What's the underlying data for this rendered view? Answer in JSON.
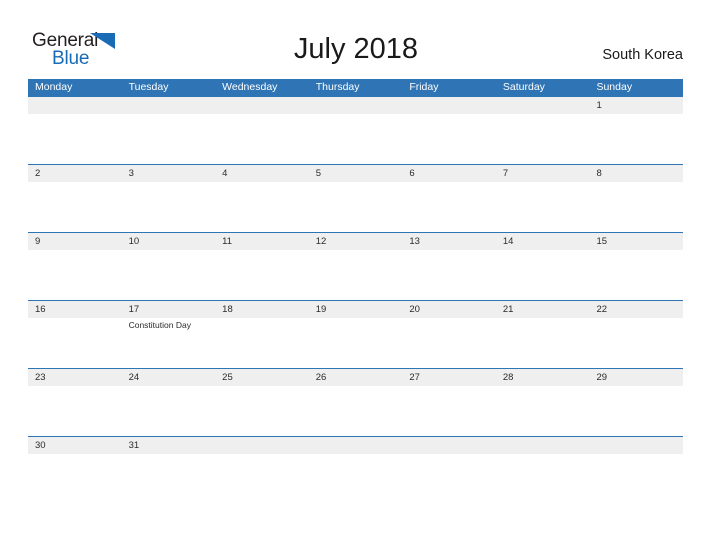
{
  "logo": {
    "word_one": "General",
    "word_two": "Blue",
    "triangle_icon": "triangle-icon",
    "dark_color": "#231f20",
    "blue_color": "#1a6bb5"
  },
  "header": {
    "title": "July 2018",
    "country": "South Korea",
    "accent_color": "#2f74b5"
  },
  "calendar": {
    "weekdays": [
      "Monday",
      "Tuesday",
      "Wednesday",
      "Thursday",
      "Friday",
      "Saturday",
      "Sunday"
    ],
    "band_color": "#efefef",
    "weeks": [
      {
        "days": [
          {
            "date": "",
            "event": ""
          },
          {
            "date": "",
            "event": ""
          },
          {
            "date": "",
            "event": ""
          },
          {
            "date": "",
            "event": ""
          },
          {
            "date": "",
            "event": ""
          },
          {
            "date": "",
            "event": ""
          },
          {
            "date": "1",
            "event": ""
          }
        ]
      },
      {
        "days": [
          {
            "date": "2",
            "event": ""
          },
          {
            "date": "3",
            "event": ""
          },
          {
            "date": "4",
            "event": ""
          },
          {
            "date": "5",
            "event": ""
          },
          {
            "date": "6",
            "event": ""
          },
          {
            "date": "7",
            "event": ""
          },
          {
            "date": "8",
            "event": ""
          }
        ]
      },
      {
        "days": [
          {
            "date": "9",
            "event": ""
          },
          {
            "date": "10",
            "event": ""
          },
          {
            "date": "11",
            "event": ""
          },
          {
            "date": "12",
            "event": ""
          },
          {
            "date": "13",
            "event": ""
          },
          {
            "date": "14",
            "event": ""
          },
          {
            "date": "15",
            "event": ""
          }
        ]
      },
      {
        "days": [
          {
            "date": "16",
            "event": ""
          },
          {
            "date": "17",
            "event": "Constitution Day"
          },
          {
            "date": "18",
            "event": ""
          },
          {
            "date": "19",
            "event": ""
          },
          {
            "date": "20",
            "event": ""
          },
          {
            "date": "21",
            "event": ""
          },
          {
            "date": "22",
            "event": ""
          }
        ]
      },
      {
        "days": [
          {
            "date": "23",
            "event": ""
          },
          {
            "date": "24",
            "event": ""
          },
          {
            "date": "25",
            "event": ""
          },
          {
            "date": "26",
            "event": ""
          },
          {
            "date": "27",
            "event": ""
          },
          {
            "date": "28",
            "event": ""
          },
          {
            "date": "29",
            "event": ""
          }
        ]
      },
      {
        "days": [
          {
            "date": "30",
            "event": ""
          },
          {
            "date": "31",
            "event": ""
          },
          {
            "date": "",
            "event": ""
          },
          {
            "date": "",
            "event": ""
          },
          {
            "date": "",
            "event": ""
          },
          {
            "date": "",
            "event": ""
          },
          {
            "date": "",
            "event": ""
          }
        ]
      }
    ]
  }
}
